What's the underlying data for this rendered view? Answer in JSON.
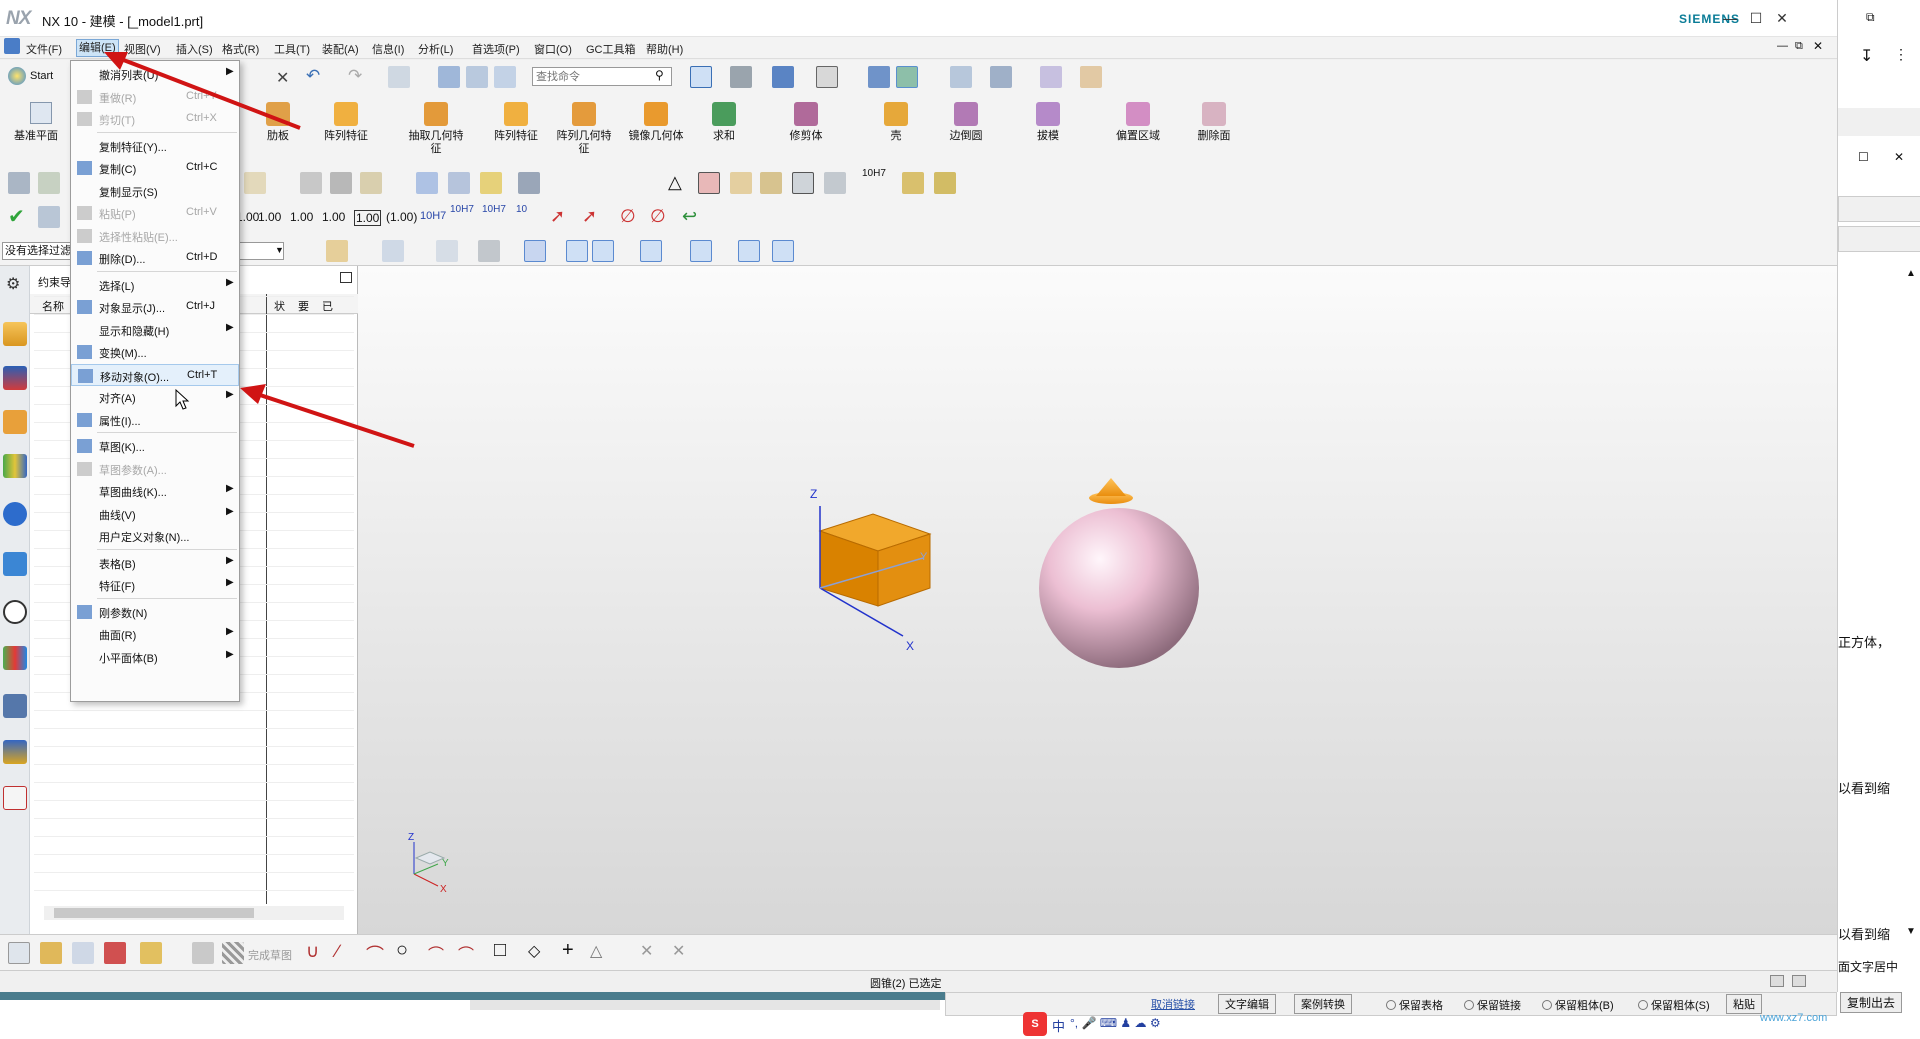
{
  "window": {
    "logo": "NX",
    "title": "NX 10 - 建模 - [_model1.prt]",
    "brand": "SIEMENS"
  },
  "menubar": {
    "items": [
      "文件(F)",
      "编辑(E)",
      "视图(V)",
      "插入(S)",
      "格式(R)",
      "工具(T)",
      "装配(A)",
      "信息(I)",
      "分析(L)",
      "首选项(P)",
      "窗口(O)",
      "GC工具箱",
      "帮助(H)"
    ],
    "active": "编辑(E)"
  },
  "toolbar": {
    "start_label": "Start",
    "search_placeholder": "查找命令",
    "datum_label": "基准平面",
    "features": [
      "肋板",
      "阵列特征",
      "抽取几何特\n征",
      "阵列特征",
      "阵列几何特\n征",
      "镜像几何体",
      "求和",
      "修剪体",
      "壳",
      "边倒圆",
      "拔模",
      "偏置区域",
      "删除面"
    ],
    "dimension_labels": [
      "1.00",
      "1.00",
      "1.00",
      "1.00",
      "1.00",
      "(1.00)",
      "10H7",
      "10H7",
      "10H7",
      "10",
      "10H7"
    ],
    "filter_value": "没有选择过滤器"
  },
  "navigator": {
    "title": "约束导航器",
    "col_name": "名称",
    "col_status": "状",
    "col_req": "要",
    "col_done": "已"
  },
  "edit_menu": {
    "items": [
      {
        "label": "撤消列表(U)",
        "shortcut": "",
        "arrow": true,
        "disabled": false,
        "icon": ""
      },
      {
        "label": "重做(R)",
        "shortcut": "Ctrl+Y",
        "arrow": false,
        "disabled": true,
        "icon": "redo-icon"
      },
      {
        "label": "剪切(T)",
        "shortcut": "Ctrl+X",
        "arrow": false,
        "disabled": true,
        "icon": "cut-icon"
      },
      {
        "label": "复制特征(Y)...",
        "shortcut": "",
        "arrow": false,
        "disabled": false,
        "icon": ""
      },
      {
        "label": "复制(C)",
        "shortcut": "Ctrl+C",
        "arrow": false,
        "disabled": false,
        "icon": "copy-icon"
      },
      {
        "label": "复制显示(S)",
        "shortcut": "",
        "arrow": false,
        "disabled": false,
        "icon": ""
      },
      {
        "label": "粘贴(P)",
        "shortcut": "Ctrl+V",
        "arrow": false,
        "disabled": true,
        "icon": "paste-icon"
      },
      {
        "label": "选择性粘贴(E)...",
        "shortcut": "",
        "arrow": false,
        "disabled": true,
        "icon": "paste-special-icon"
      },
      {
        "label": "删除(D)...",
        "shortcut": "Ctrl+D",
        "arrow": false,
        "disabled": false,
        "icon": "delete-icon"
      },
      {
        "label": "选择(L)",
        "shortcut": "",
        "arrow": true,
        "disabled": false,
        "icon": ""
      },
      {
        "label": "对象显示(J)...",
        "shortcut": "Ctrl+J",
        "arrow": false,
        "disabled": false,
        "icon": "object-display-icon"
      },
      {
        "label": "显示和隐藏(H)",
        "shortcut": "",
        "arrow": true,
        "disabled": false,
        "icon": ""
      },
      {
        "label": "变换(M)...",
        "shortcut": "",
        "arrow": false,
        "disabled": false,
        "icon": "transform-icon"
      },
      {
        "label": "移动对象(O)...",
        "shortcut": "Ctrl+T",
        "arrow": false,
        "disabled": false,
        "icon": "move-object-icon"
      },
      {
        "label": "对齐(A)",
        "shortcut": "",
        "arrow": true,
        "disabled": false,
        "icon": ""
      },
      {
        "label": "属性(I)...",
        "shortcut": "",
        "arrow": false,
        "disabled": false,
        "icon": "properties-icon"
      },
      {
        "label": "草图(K)...",
        "shortcut": "",
        "arrow": false,
        "disabled": false,
        "icon": "sketch-icon"
      },
      {
        "label": "草图参数(A)...",
        "shortcut": "",
        "arrow": false,
        "disabled": true,
        "icon": "sketch-params-icon"
      },
      {
        "label": "草图曲线(K)...",
        "shortcut": "",
        "arrow": true,
        "disabled": false,
        "icon": ""
      },
      {
        "label": "曲线(V)",
        "shortcut": "",
        "arrow": true,
        "disabled": false,
        "icon": ""
      },
      {
        "label": "用户定义对象(N)...",
        "shortcut": "",
        "arrow": false,
        "disabled": false,
        "icon": ""
      },
      {
        "label": "表格(B)",
        "shortcut": "",
        "arrow": true,
        "disabled": false,
        "icon": ""
      },
      {
        "label": "特征(F)",
        "shortcut": "",
        "arrow": true,
        "disabled": false,
        "icon": ""
      },
      {
        "label": "刚参数(N)",
        "shortcut": "",
        "arrow": false,
        "disabled": false,
        "icon": "parameters-icon"
      },
      {
        "label": "曲面(R)",
        "shortcut": "",
        "arrow": true,
        "disabled": false,
        "icon": ""
      },
      {
        "label": "小平面体(B)",
        "shortcut": "",
        "arrow": true,
        "disabled": false,
        "icon": ""
      }
    ],
    "highlighted": "移动对象(O)..."
  },
  "viewport": {
    "axis_x": "X",
    "axis_y": "Y",
    "axis_z": "Z"
  },
  "bottom_toolbar": {
    "finish_sketch": "完成草图"
  },
  "status": {
    "message": "圆锥(2) 已选定"
  },
  "right_panel": {
    "snippets": [
      "正方体，",
      "以看到缩",
      "以看到缩",
      "面文字居中"
    ]
  },
  "taskbar": {
    "link": "取消链接",
    "btn1": "文字编辑",
    "btn2": "案例转换",
    "opt1": "保留表格",
    "opt2": "保留链接",
    "opt3": "保留粗体(B)",
    "opt4": "保留粗体(S)",
    "btn3": "粘贴",
    "btn4": "复制出去",
    "ime": "中",
    "watermark": "www.xz7.com"
  },
  "colors": {
    "menu_highlight": "#e4f0fb",
    "cube": "#e8920f",
    "sphere": "#e8c0cf",
    "arrow": "#d01414",
    "siemens": "#0a7c97"
  }
}
